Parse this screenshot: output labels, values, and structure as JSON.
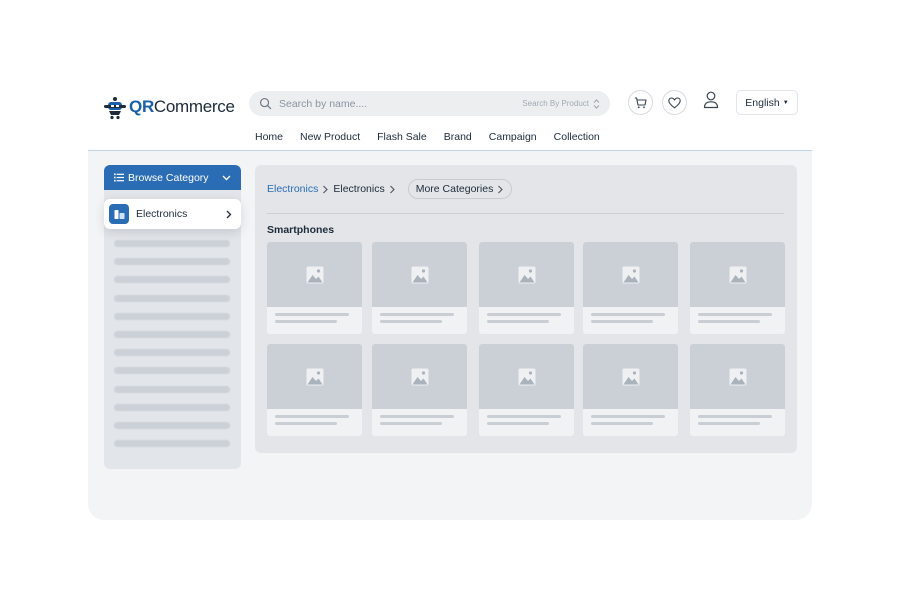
{
  "header": {
    "logo": {
      "brand_q": "Q",
      "brand_r": "R",
      "brand_rest": "Commerce"
    },
    "search": {
      "placeholder": "Search by name....",
      "scope": "Search By Product"
    },
    "language": "English"
  },
  "nav": {
    "items": [
      "Home",
      "New Product",
      "Flash Sale",
      "Brand",
      "Campaign",
      "Collection"
    ]
  },
  "sidebar": {
    "browse_label": "Browse Category",
    "selected_category": "Electronics",
    "placeholder_rows": 12
  },
  "content": {
    "breadcrumb": {
      "root": "Electronics",
      "current": "Electronics",
      "more": "More Categories"
    },
    "section_title": "Smartphones",
    "product_placeholders": 10
  },
  "colors": {
    "primary": "#2a6db5",
    "text": "#1d2b3a",
    "panel_bg": "#f3f4f5",
    "skeleton": "#cbd0d7"
  },
  "icons": {
    "search": "search-icon",
    "cart": "cart-icon",
    "wishlist": "heart-icon",
    "account": "user-icon",
    "image_placeholder": "image-icon"
  }
}
